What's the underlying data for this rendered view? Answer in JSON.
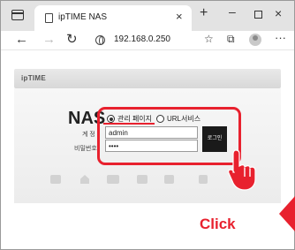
{
  "browser": {
    "tab_title": "ipTIME NAS",
    "tab_close": "×",
    "new_tab": "+",
    "minimize": "–",
    "close": "×",
    "url": "192.168.0.250",
    "more": "···"
  },
  "page": {
    "logo": "ipTIME",
    "title": "NAS",
    "radio_admin_label": "관리 페이지",
    "radio_url_label": "URL서비스",
    "id_label": "계 정",
    "pw_label": "비밀번호",
    "id_value": "admin",
    "pw_value": "••••",
    "login_label": "로그인"
  },
  "annotation": {
    "click_text": "Click",
    "highlight_color": "#e8212e"
  },
  "service_icons": [
    "disk-icon",
    "home-icon",
    "monitor-icon",
    "photo-icon",
    "video-icon",
    "music-icon",
    "phone-icon"
  ]
}
